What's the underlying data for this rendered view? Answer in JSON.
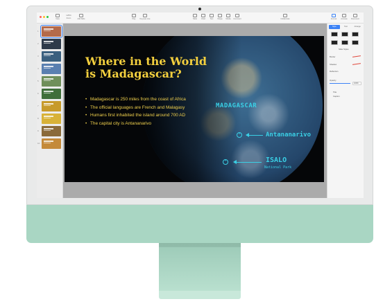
{
  "toolbar": {
    "items": [
      "View",
      "Zoom",
      "Add Slide",
      "Play",
      "Keynote Live",
      "Table",
      "Chart",
      "Text",
      "Shape",
      "Media",
      "Comment",
      "Collaborate",
      "Format",
      "Animate",
      "Document"
    ],
    "zoom_value": "125%"
  },
  "navigator": {
    "slide_numbers": [
      "1",
      "2",
      "3",
      "4",
      "5",
      "6",
      "7",
      "8",
      "9",
      "10"
    ],
    "thumbnail_colors": [
      "#b46a4a",
      "#2e3a4a",
      "#3a5f7f",
      "#5a7fb0",
      "#6f8f5a",
      "#3f6e3a",
      "#c79a2a",
      "#d8b238",
      "#8a6a3a",
      "#c48a3a"
    ]
  },
  "slide": {
    "title": "Where in the World is Madagascar?",
    "bullets": [
      "Madagascar is 250 miles from the coast of Africa",
      "The official languages are French and Malagasy",
      "Humans first inhabited the island around 700 AD",
      "The capital city is Antananarivo"
    ],
    "annotations": {
      "country": "MADAGASCAR",
      "capital": "Antananarivo",
      "park": "ISALO",
      "park_sub": "National Park"
    },
    "colors": {
      "title": "#f3cf3e",
      "bullets": "#f1d14d",
      "annotation": "#3ad0e6",
      "background": "#050608"
    }
  },
  "inspector": {
    "tabs": [
      "Style",
      "Text",
      "Arrange"
    ],
    "sections": [
      "Slide Styles",
      "Border",
      "Shadow",
      "Reflection",
      "Opacity",
      "Title",
      "Caption"
    ],
    "opacity_value": "100%"
  }
}
